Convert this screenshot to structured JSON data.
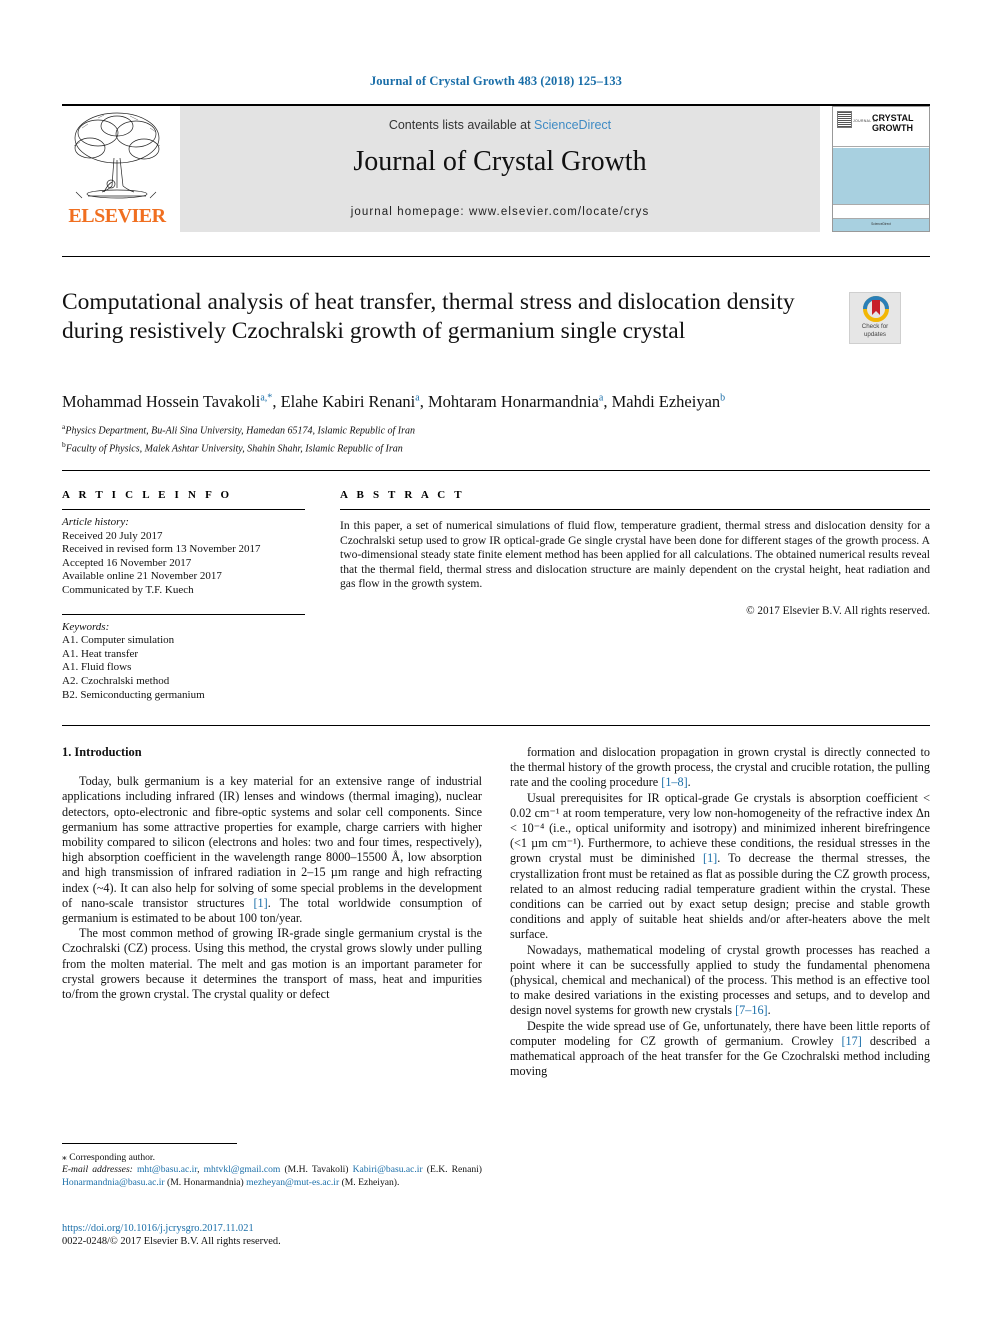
{
  "running_head": "Journal of Crystal Growth 483 (2018) 125–133",
  "masthead": {
    "contents_prefix": "Contents lists available at ",
    "sciencedirect": "ScienceDirect",
    "journal_name": "Journal of Crystal Growth",
    "homepage": "journal homepage: www.elsevier.com/locate/crys",
    "publisher_logo_text": "ELSEVIER",
    "cover": {
      "journal_of": "JOURNAL OF",
      "title_line1": "CRYSTAL",
      "title_line2": "GROWTH",
      "footer_text": "ScienceDirect"
    },
    "colors": {
      "band": "#e3e3e3",
      "link": "#3f8bc4",
      "elsevier_orange": "#f06f20",
      "cover_blue": "#a8d0e0"
    }
  },
  "article": {
    "title": "Computational analysis of heat transfer, thermal stress and dislocation density during resistively Czochralski growth of germanium single crystal",
    "crossmark": {
      "line1": "Check for",
      "line2": "updates",
      "icon": "check-for-updates-icon"
    },
    "authors_html": "Mohammad Hossein Tavakoli<sup>a,*</sup>, Elahe Kabiri Renani<sup>a</sup>, Mohtaram Honarmandnia<sup>a</sup>, Mahdi Ezheiyan<sup>b</sup>",
    "affiliations": [
      {
        "marker": "a",
        "text": "Physics Department, Bu-Ali Sina University, Hamedan 65174, Islamic Republic of Iran"
      },
      {
        "marker": "b",
        "text": "Faculty of Physics, Malek Ashtar University, Shahin Shahr, Islamic Republic of Iran"
      }
    ]
  },
  "info": {
    "heading": "A R T I C L E  I N F O",
    "history_label": "Article history:",
    "history": [
      "Received 20 July 2017",
      "Received in revised form 13 November 2017",
      "Accepted 16 November 2017",
      "Available online 21 November 2017",
      "Communicated by T.F. Kuech"
    ],
    "keywords_label": "Keywords:",
    "keywords": [
      "A1. Computer simulation",
      "A1. Heat transfer",
      "A1. Fluid flows",
      "A2. Czochralski method",
      "B2. Semiconducting germanium"
    ]
  },
  "abstract": {
    "heading": "A B S T R A C T",
    "text": "In this paper, a set of numerical simulations of fluid flow, temperature gradient, thermal stress and dislocation density for a Czochralski setup used to grow IR optical-grade Ge single crystal have been done for different stages of the growth process. A two-dimensional steady state finite element method has been applied for all calculations. The obtained numerical results reveal that the thermal field, thermal stress and dislocation structure are mainly dependent on the crystal height, heat radiation and gas flow in the growth system.",
    "copyright": "© 2017 Elsevier B.V. All rights reserved."
  },
  "body": {
    "section_heading": "1. Introduction",
    "left_paragraphs": [
      "Today, bulk germanium is a key material for an extensive range of industrial applications including infrared (IR) lenses and windows (thermal imaging), nuclear detectors, opto-electronic and fibre-optic systems and solar cell components. Since germanium has some attractive properties for example, charge carriers with higher mobility compared to silicon (electrons and holes: two and four times, respectively), high absorption coefficient in the wavelength range 8000–15500 Å, low absorption and high transmission of infrared radiation in 2–15 µm range and high refracting index (~4). It can also help for solving of some special problems in the development of nano-scale transistor structures [1]. The total worldwide consumption of germanium is estimated to be about 100 ton/year.",
      "The most common method of growing IR-grade single germanium crystal is the Czochralski (CZ) process. Using this method, the crystal grows slowly under pulling from the molten material. The melt and gas motion is an important parameter for crystal growers because it determines the transport of mass, heat and impurities to/from the grown crystal. The crystal quality or defect"
    ],
    "right_paragraphs": [
      "formation and dislocation propagation in grown crystal is directly connected to the thermal history of the growth process, the crystal and crucible rotation, the pulling rate and the cooling procedure [1–8].",
      "Usual prerequisites for IR optical-grade Ge crystals is absorption coefficient < 0.02 cm⁻¹ at room temperature, very low non-homogeneity of the refractive index Δn < 10⁻⁴ (i.e., optical uniformity and isotropy) and minimized inherent birefringence (<1 µm cm⁻¹). Furthermore, to achieve these conditions, the residual stresses in the grown crystal must be diminished [1]. To decrease the thermal stresses, the crystallization front must be retained as flat as possible during the CZ growth process, related to an almost reducing radial temperature gradient within the crystal. These conditions can be carried out by exact setup design; precise and stable growth conditions and apply of suitable heat shields and/or after-heaters above the melt surface.",
      "Nowadays, mathematical modeling of crystal growth processes has reached a point where it can be successfully applied to study the fundamental phenomena (physical, chemical and mechanical) of the process. This method is an effective tool to make desired variations in the existing processes and setups, and to develop and design novel systems for growth new crystals [7–16].",
      "Despite the wide spread use of Ge, unfortunately, there have been little reports of computer modeling for CZ growth of germanium. Crowley [17] described a mathematical approach of the heat transfer for the Ge Czochralski method including moving"
    ]
  },
  "footnotes": {
    "corresponding": "⁎ Corresponding author.",
    "email_label": "E-mail addresses:",
    "emails": [
      {
        "address": "mht@basu.ac.ir",
        "owner": ""
      },
      {
        "address": "mhtvkl@gmail.com",
        "owner": "(M.H. Tavakoli)"
      },
      {
        "address": "Kabiri@basu.ac.ir",
        "owner": "(E.K. Renani)"
      },
      {
        "address": "Honarmandnia@basu.ac.ir",
        "owner": "(M. Honarmandnia)"
      },
      {
        "address": "mezheyan@mut-es.ac.ir",
        "owner": "(M. Ezheiyan)."
      }
    ],
    "doi": "https://doi.org/10.1016/j.jcrysgro.2017.11.021",
    "issn_line": "0022-0248/© 2017 Elsevier B.V. All rights reserved."
  }
}
